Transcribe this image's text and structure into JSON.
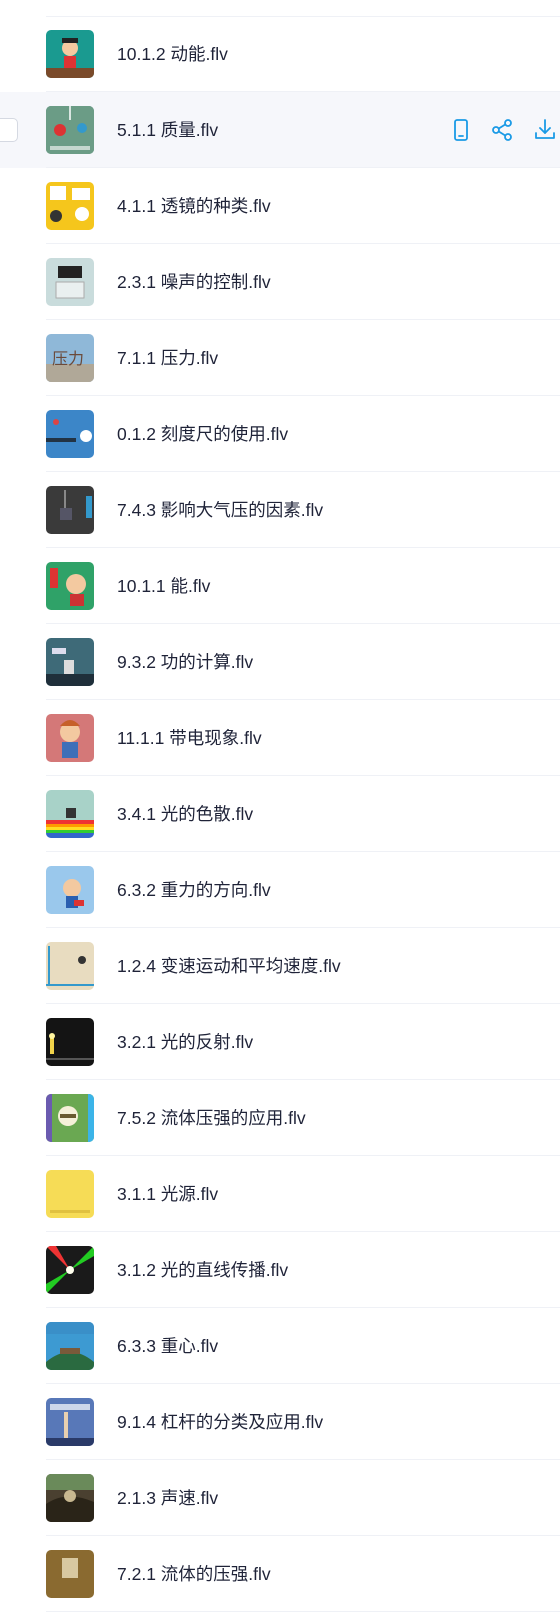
{
  "files": [
    {
      "name": "10.1.2 动能.flv",
      "thumb": "thumb-ke",
      "bg": "#1a9a90"
    },
    {
      "name": "5.1.1 质量.flv",
      "thumb": "thumb-mass",
      "bg": "#5c8a7a",
      "hover": true
    },
    {
      "name": "4.1.1 透镜的种类.flv",
      "thumb": "thumb-lens",
      "bg": "#f5c61c"
    },
    {
      "name": "2.3.1 噪声的控制.flv",
      "thumb": "thumb-noise",
      "bg": "#c9dcdc"
    },
    {
      "name": "7.1.1 压力.flv",
      "thumb": "thumb-pressure",
      "bg": "#8fb8d8"
    },
    {
      "name": "0.1.2 刻度尺的使用.flv",
      "thumb": "thumb-ruler",
      "bg": "#3c86c8"
    },
    {
      "name": "7.4.3 影响大气压的因素.flv",
      "thumb": "thumb-atm",
      "bg": "#3a3a3a"
    },
    {
      "name": "10.1.1 能.flv",
      "thumb": "thumb-energy",
      "bg": "#2fa268"
    },
    {
      "name": "9.3.2 功的计算.flv",
      "thumb": "thumb-work",
      "bg": "#3e6a78"
    },
    {
      "name": "11.1.1 带电现象.flv",
      "thumb": "thumb-charge",
      "bg": "#d47878"
    },
    {
      "name": "3.4.1 光的色散.flv",
      "thumb": "thumb-disp",
      "bg": "#a8d2c8"
    },
    {
      "name": "6.3.2 重力的方向.flv",
      "thumb": "thumb-gravity",
      "bg": "#9ac8ec"
    },
    {
      "name": "1.2.4 变速运动和平均速度.flv",
      "thumb": "thumb-speed",
      "bg": "#e8dcc0"
    },
    {
      "name": "3.2.1 光的反射.flv",
      "thumb": "thumb-reflect",
      "bg": "#141414"
    },
    {
      "name": "7.5.2 流体压强的应用.flv",
      "thumb": "thumb-fluid",
      "bg": "#6aa852"
    },
    {
      "name": "3.1.1 光源.flv",
      "thumb": "thumb-light",
      "bg": "#f6dc56"
    },
    {
      "name": "3.1.2 光的直线传播.flv",
      "thumb": "thumb-straight",
      "bg": "#1a1a1a"
    },
    {
      "name": "6.3.3 重心.flv",
      "thumb": "thumb-cog",
      "bg": "#3d9ad2"
    },
    {
      "name": "9.1.4 杠杆的分类及应用.flv",
      "thumb": "thumb-lever",
      "bg": "#5878b8"
    },
    {
      "name": "2.1.3 声速.flv",
      "thumb": "thumb-sound",
      "bg": "#4a4030"
    },
    {
      "name": "7.2.1 流体的压强.flv",
      "thumb": "thumb-fluid2",
      "bg": "#8a6a30"
    }
  ],
  "actions": {
    "phone": {
      "icon": "mobile-icon",
      "color": "#1a9ae6"
    },
    "share": {
      "icon": "share-icon",
      "color": "#1a9ae6"
    },
    "download": {
      "icon": "download-icon",
      "color": "#1a9ae6"
    }
  }
}
